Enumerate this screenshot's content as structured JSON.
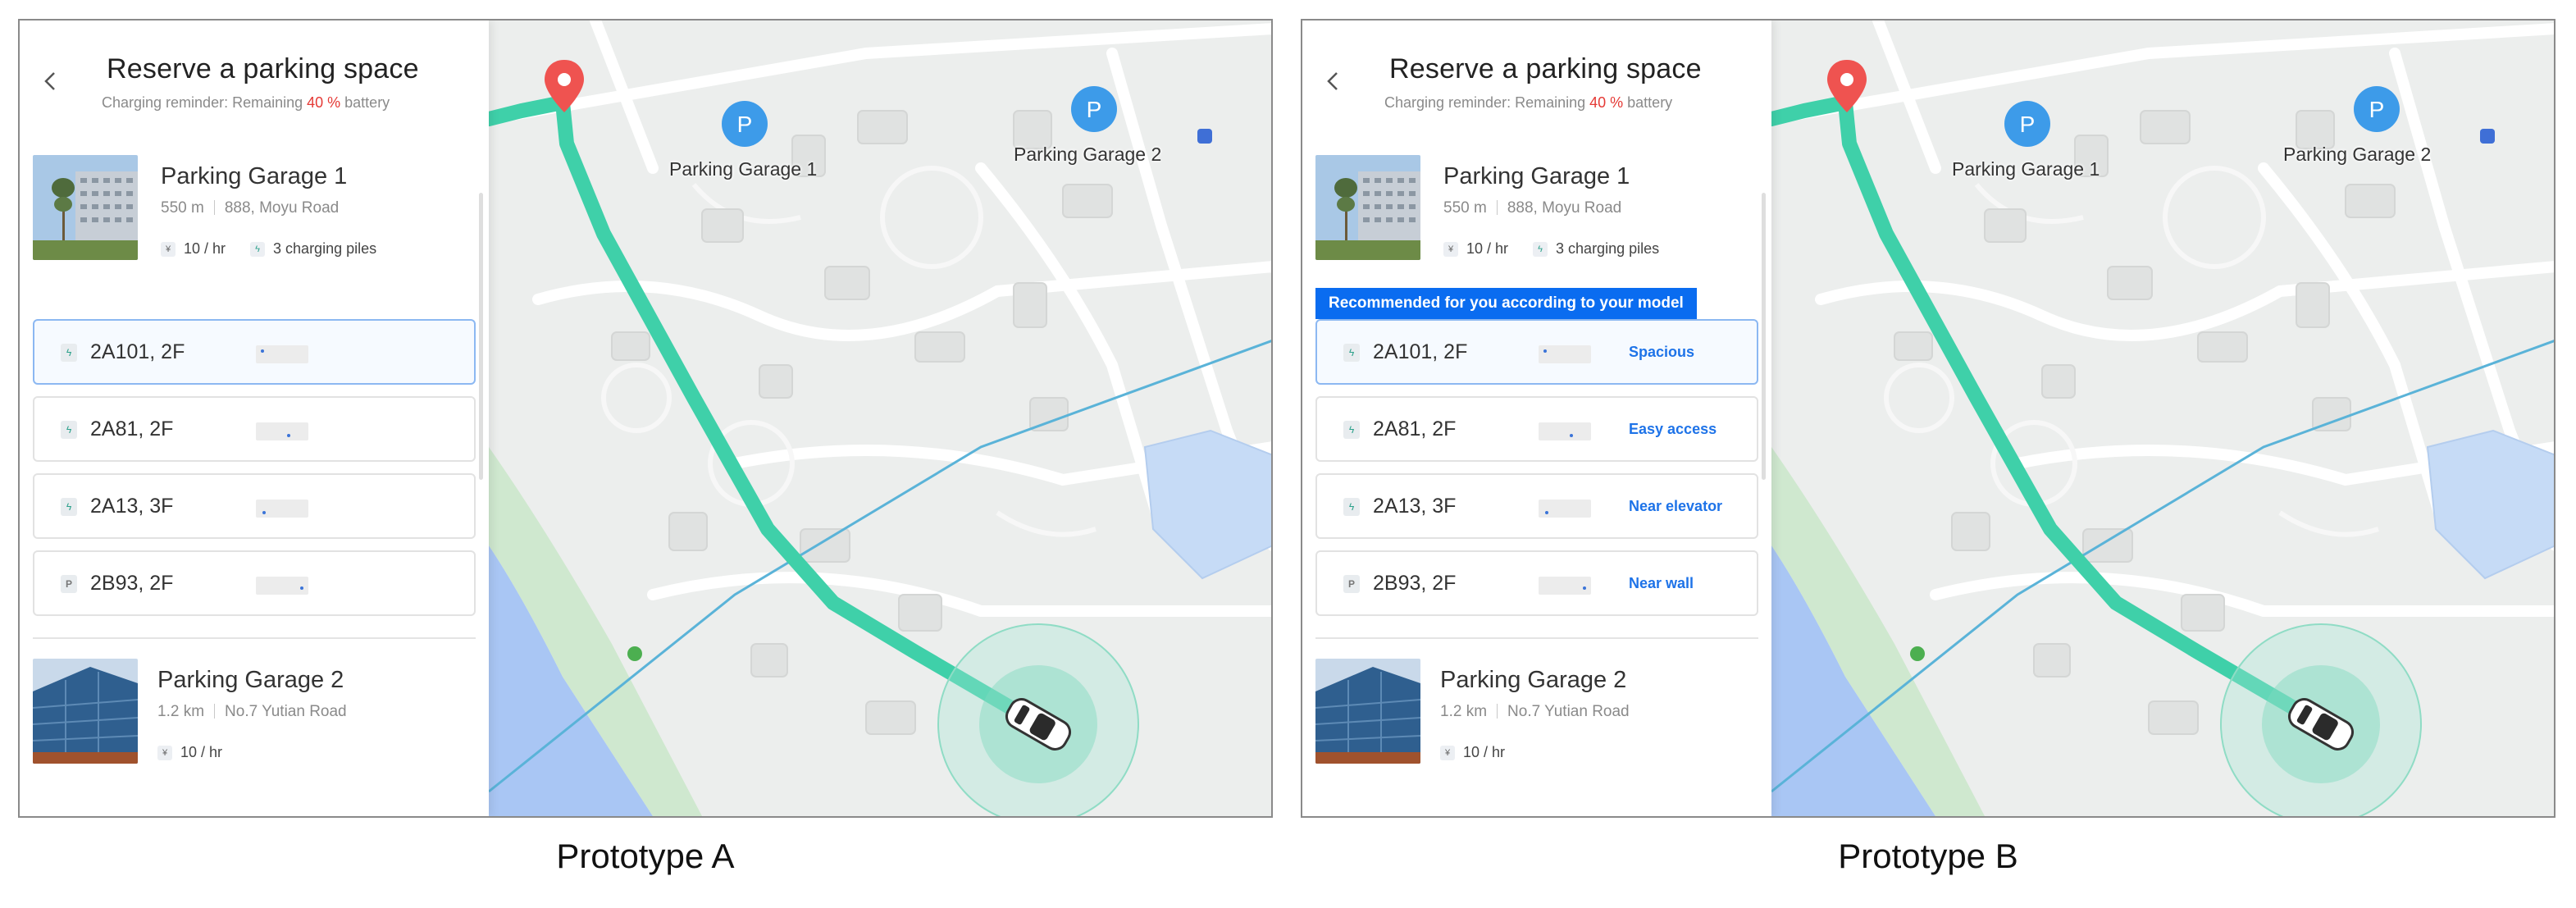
{
  "prototypes": [
    {
      "caption": "Prototype A",
      "panel": {
        "title": "Reserve a parking space",
        "reminder_prefix": "Charging reminder: Remaining ",
        "reminder_pct": "40 %",
        "reminder_suffix": " battery",
        "recommendation_banner": "",
        "garages": [
          {
            "name": "Parking Garage 1",
            "distance": "550 m",
            "address": "888, Moyu Road",
            "price": "10 / hr",
            "charging": "3 charging piles"
          },
          {
            "name": "Parking Garage 2",
            "distance": "1.2 km",
            "address": "No.7 Yutian Road",
            "price": "10 / hr"
          }
        ],
        "spots": [
          {
            "label": "2A101, 2F",
            "feature": ""
          },
          {
            "label": "2A81, 2F",
            "feature": ""
          },
          {
            "label": "2A13, 3F",
            "feature": ""
          },
          {
            "label": "2B93, 2F",
            "feature": ""
          }
        ],
        "currency_icon": "yen-icon",
        "charge_icon": "lightning-icon",
        "p_icon": "parking-icon"
      },
      "map": {
        "label_g1": "Parking Garage 1",
        "label_g2": "Parking Garage 2",
        "marker_letter": "P"
      }
    },
    {
      "caption": "Prototype B",
      "panel": {
        "title": "Reserve a parking space",
        "reminder_prefix": "Charging reminder: Remaining ",
        "reminder_pct": "40 %",
        "reminder_suffix": " battery",
        "recommendation_banner": "Recommended for you according to your model",
        "garages": [
          {
            "name": "Parking Garage 1",
            "distance": "550 m",
            "address": "888, Moyu Road",
            "price": "10 / hr",
            "charging": "3 charging piles"
          },
          {
            "name": "Parking Garage 2",
            "distance": "1.2 km",
            "address": "No.7 Yutian Road",
            "price": "10 / hr"
          }
        ],
        "spots": [
          {
            "label": "2A101, 2F",
            "feature": "Spacious"
          },
          {
            "label": "2A81, 2F",
            "feature": "Easy access"
          },
          {
            "label": "2A13, 3F",
            "feature": "Near elevator"
          },
          {
            "label": "2B93, 2F",
            "feature": "Near wall"
          }
        ],
        "currency_icon": "yen-icon",
        "charge_icon": "lightning-icon",
        "p_icon": "parking-icon"
      },
      "map": {
        "label_g1": "Parking Garage 1",
        "label_g2": "Parking Garage 2",
        "marker_letter": "P"
      }
    }
  ],
  "colors": {
    "route": "#3fd0a9",
    "accent_blue": "#1e73e8",
    "banner_blue": "#0a6cf0",
    "battery_red": "#e53935",
    "marker_blue": "#3d9be9",
    "pin_red": "#ef5350",
    "water": "#a9c6f4",
    "park_green": "#cfe8cf"
  }
}
